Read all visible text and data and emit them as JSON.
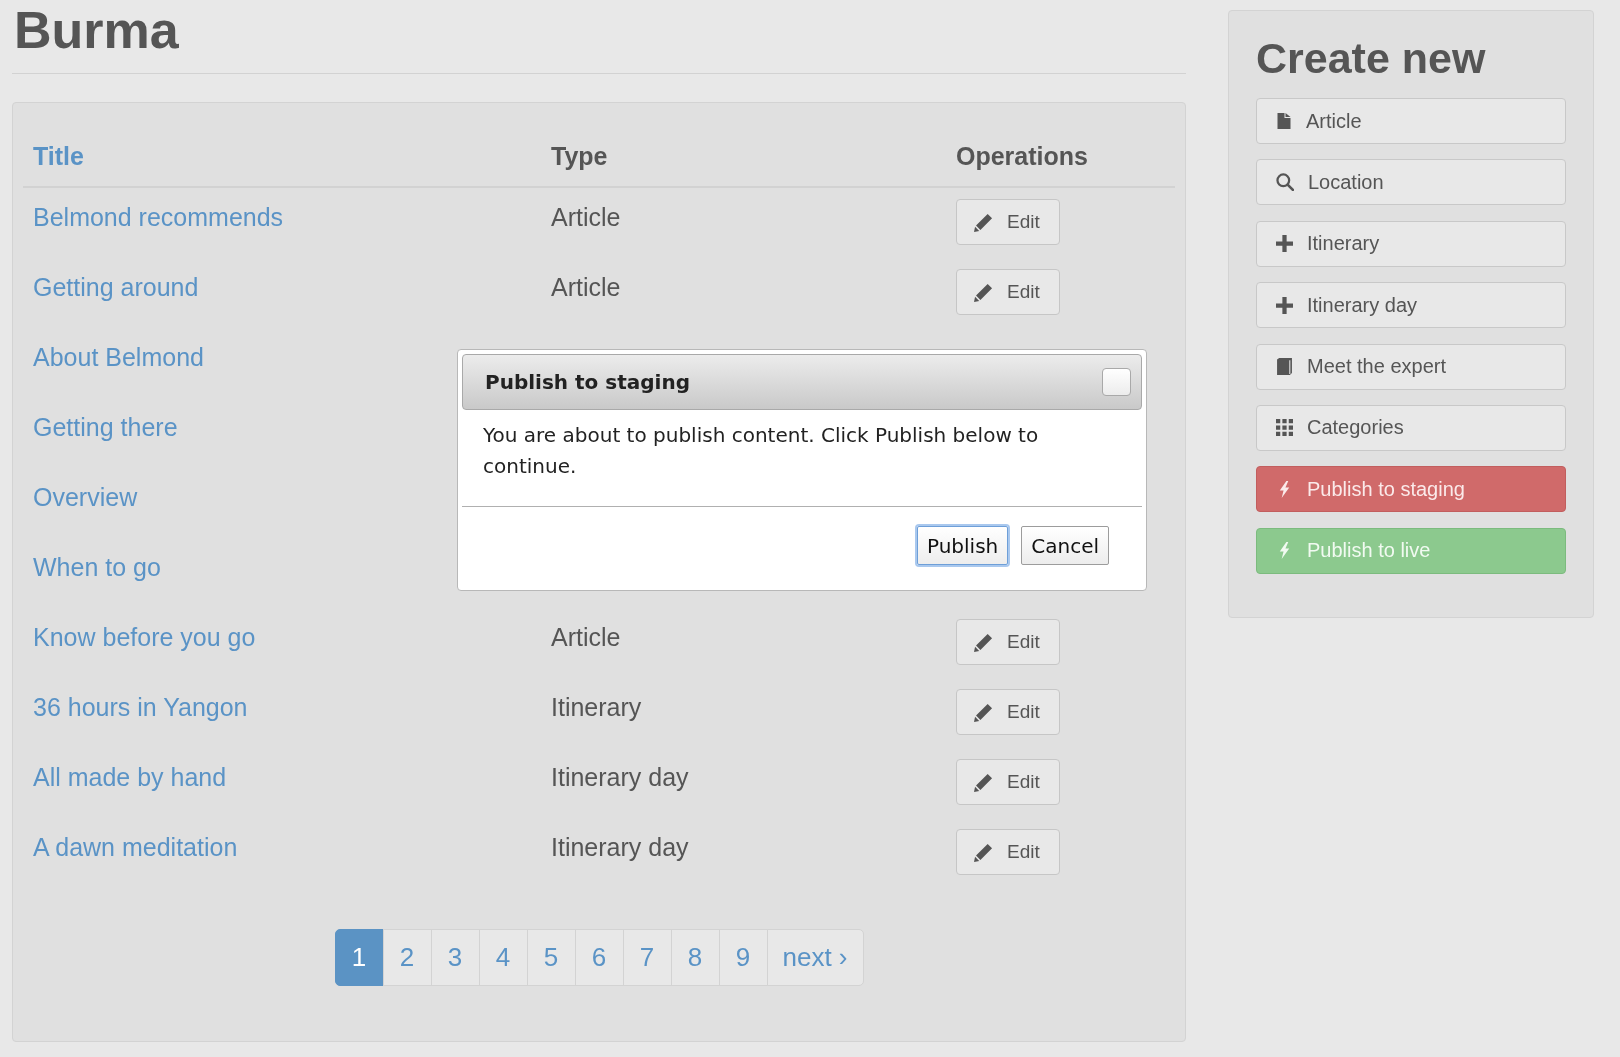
{
  "page": {
    "title": "Burma"
  },
  "table": {
    "columns": [
      {
        "label": "Title",
        "link": true
      },
      {
        "label": "Type",
        "link": false
      },
      {
        "label": "Operations",
        "link": false
      }
    ],
    "rows": [
      {
        "title": "Belmond recommends",
        "type": "Article",
        "edit": "Edit"
      },
      {
        "title": "Getting around",
        "type": "Article",
        "edit": "Edit"
      },
      {
        "title": "About Belmond"
      },
      {
        "title": "Getting there"
      },
      {
        "title": "Overview"
      },
      {
        "title": "When to go"
      },
      {
        "title": "Know before you go",
        "type": "Article",
        "edit": "Edit"
      },
      {
        "title": "36 hours in Yangon",
        "type": "Itinerary",
        "edit": "Edit"
      },
      {
        "title": "All made by hand",
        "type": "Itinerary day",
        "edit": "Edit"
      },
      {
        "title": "A dawn meditation",
        "type": "Itinerary day",
        "edit": "Edit"
      }
    ]
  },
  "pagination": {
    "pages": [
      {
        "label": "1",
        "selected": true
      },
      {
        "label": "2",
        "selected": false
      },
      {
        "label": "3",
        "selected": false
      },
      {
        "label": "4",
        "selected": false
      },
      {
        "label": "5",
        "selected": false
      },
      {
        "label": "6",
        "selected": false
      },
      {
        "label": "7",
        "selected": false
      },
      {
        "label": "8",
        "selected": false
      },
      {
        "label": "9",
        "selected": false
      }
    ],
    "next": "next ›"
  },
  "sidebar": {
    "title": "Create new",
    "items": [
      {
        "label": "Article",
        "kind": "article"
      },
      {
        "label": "Location",
        "kind": "location"
      },
      {
        "label": "Itinerary",
        "kind": "itinerary"
      },
      {
        "label": "Itinerary day",
        "kind": "itinerary_day"
      },
      {
        "label": "Meet the expert",
        "kind": "expert"
      },
      {
        "label": "Categories",
        "kind": "categories"
      },
      {
        "label": "Publish to staging",
        "kind": "staging"
      },
      {
        "label": "Publish to live",
        "kind": "live"
      }
    ]
  },
  "dialog": {
    "title": "Publish to staging",
    "message": "You are about to publish content. Click Publish below to continue.",
    "buttons": [
      {
        "label": "Publish",
        "focused": true
      },
      {
        "label": "Cancel",
        "focused": false
      }
    ]
  }
}
